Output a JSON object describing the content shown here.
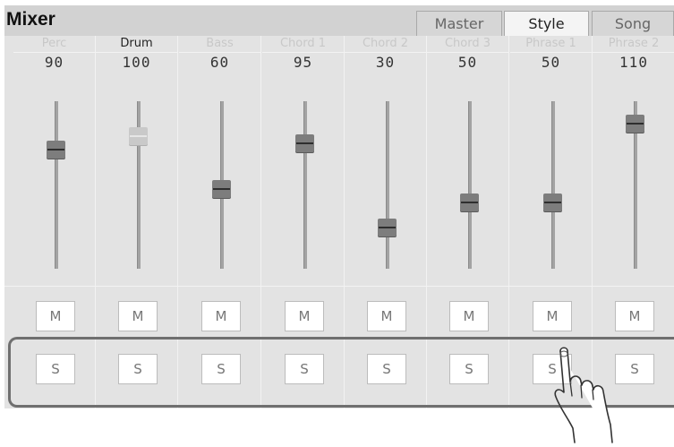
{
  "window": {
    "title": "Mixer"
  },
  "tabs": [
    {
      "label": "Master",
      "active": false
    },
    {
      "label": "Style",
      "active": true
    },
    {
      "label": "Song",
      "active": false
    }
  ],
  "channels": [
    {
      "name": "Perc",
      "value": "90",
      "active": false,
      "mute_label": "M",
      "solo_label": "S"
    },
    {
      "name": "Drum",
      "value": "100",
      "active": true,
      "mute_label": "M",
      "solo_label": "S"
    },
    {
      "name": "Bass",
      "value": "60",
      "active": false,
      "mute_label": "M",
      "solo_label": "S"
    },
    {
      "name": "Chord 1",
      "value": "95",
      "active": false,
      "mute_label": "M",
      "solo_label": "S"
    },
    {
      "name": "Chord 2",
      "value": "30",
      "active": false,
      "mute_label": "M",
      "solo_label": "S"
    },
    {
      "name": "Chord 3",
      "value": "50",
      "active": false,
      "mute_label": "M",
      "solo_label": "S"
    },
    {
      "name": "Phrase 1",
      "value": "50",
      "active": false,
      "mute_label": "M",
      "solo_label": "S"
    },
    {
      "name": "Phrase 2",
      "value": "110",
      "active": false,
      "mute_label": "M",
      "solo_label": "S"
    }
  ],
  "colors": {
    "panel": "#e3e3e3",
    "titlebar": "#d2d2d2",
    "knob": "#7d7d7d",
    "highlight": "#6f6f6f"
  },
  "icons": {
    "pointer": "hand-pointer-icon"
  }
}
